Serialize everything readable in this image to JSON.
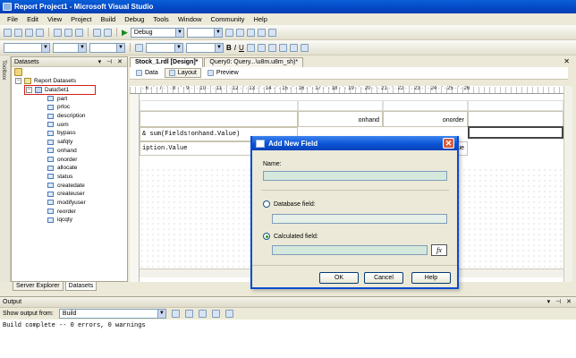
{
  "window": {
    "title": "Report Project1 - Microsoft Visual Studio"
  },
  "menu": [
    "File",
    "Edit",
    "View",
    "Project",
    "Build",
    "Debug",
    "Tools",
    "Window",
    "Community",
    "Help"
  ],
  "toolbar": {
    "config": "Debug"
  },
  "datasets_panel": {
    "title": "Datasets",
    "root": "Report Datasets",
    "dataset": "DataSet1",
    "fields": [
      "part",
      "prloc",
      "description",
      "uom",
      "bypass",
      "safqty",
      "onhand",
      "onorder",
      "allocate",
      "status",
      "createdate",
      "createuser",
      "modifyuser",
      "reorder",
      "iqcqty"
    ]
  },
  "toolbox_strip": {
    "label": "Toolbox"
  },
  "bottom_tabs": [
    "Server Explorer",
    "Datasets"
  ],
  "doc_tabs": [
    "Stock_1.rdl [Design]*",
    "Query0: Query...\\u8m.u8m_sh)*"
  ],
  "sub_tabs": [
    "Data",
    "Layout",
    "Preview"
  ],
  "ruler": {
    "ticks": "· 6 · ' · 7 · ' · 8 · ' · 9 · ' · 10 · ' · 11 · ' · 12 · ' · 13 · ' · 14 · ' · 15 · ' · 16 · ' · 17 · ' · 18 · ' · 19 · ' · 20 · ' · 21 · ' · 22 · ' · 23 · ' · 24 · ' · 25 · ' · 26"
  },
  "report": {
    "header_cells": [
      "onhand",
      "onorder"
    ],
    "expr1": "& sum(Fields!onhand.Value)",
    "expr2": "iption.Value",
    "partial": "ue"
  },
  "dialog": {
    "title": "Add New Field",
    "name_label": "Name:",
    "database_field_label": "Database field:",
    "calculated_field_label": "Calculated field:",
    "fx": "fx",
    "ok": "OK",
    "cancel": "Cancel",
    "help": "Help"
  },
  "output": {
    "title": "Output",
    "show_from_label": "Show output from:",
    "show_from_value": "Build",
    "text": "Build complete -- 0 errors, 0 warnings"
  }
}
